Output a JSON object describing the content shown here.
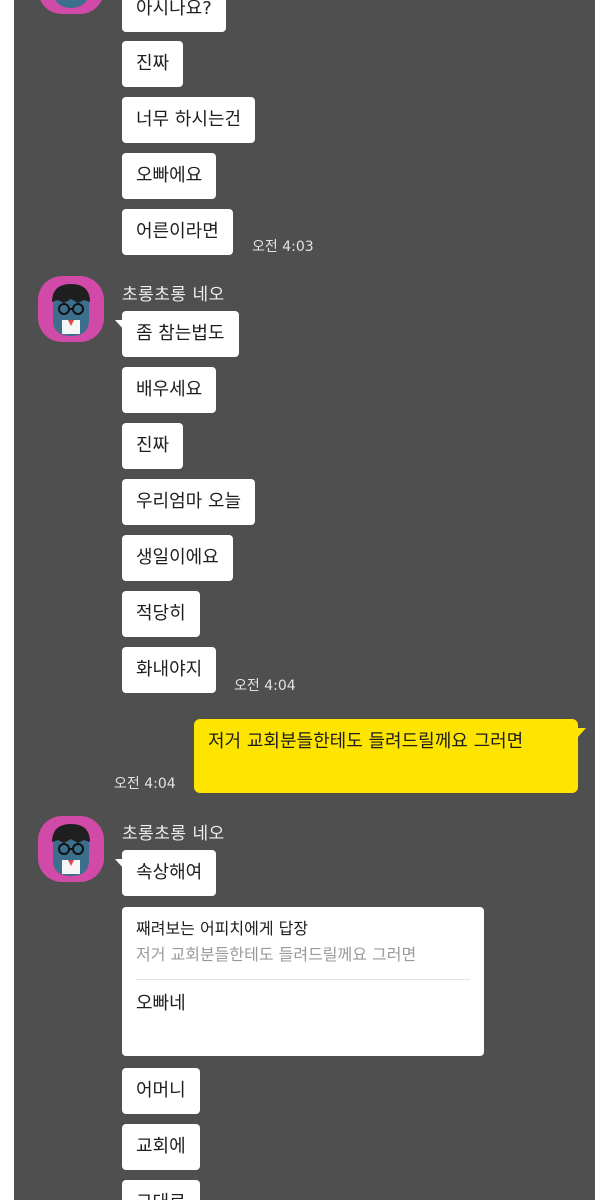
{
  "chat": {
    "sender_name": "초롱초롱 네오",
    "group1": [
      "아시나요?",
      "진짜",
      "너무 하시는건",
      "오빠에요",
      "어른이라면"
    ],
    "group1_time": "오전 4:03",
    "group2": [
      "좀 참는법도",
      "배우세요",
      "진짜",
      "우리엄마 오늘",
      "생일이에요",
      "적당히",
      "화내야지"
    ],
    "group2_time": "오전 4:04",
    "my_message": {
      "text": "저거 교회분들한테도 들려드릴께요 그러면",
      "time": "오전 4:04"
    },
    "group3_first": "속상해여",
    "reply": {
      "title": "째려보는 어피치에게 답장",
      "quote": "저거 교회분들한테도 들려드릴께요 그러면",
      "text": "오빠네"
    },
    "group3": [
      "어머니",
      "교회에",
      "그대로"
    ]
  },
  "colors": {
    "chat_background": "#4f4f4f",
    "my_bubble": "#fee500",
    "other_bubble": "#ffffff",
    "avatar_background": "#d24aa7"
  },
  "icons": {
    "avatar": "neo-character-avatar"
  }
}
